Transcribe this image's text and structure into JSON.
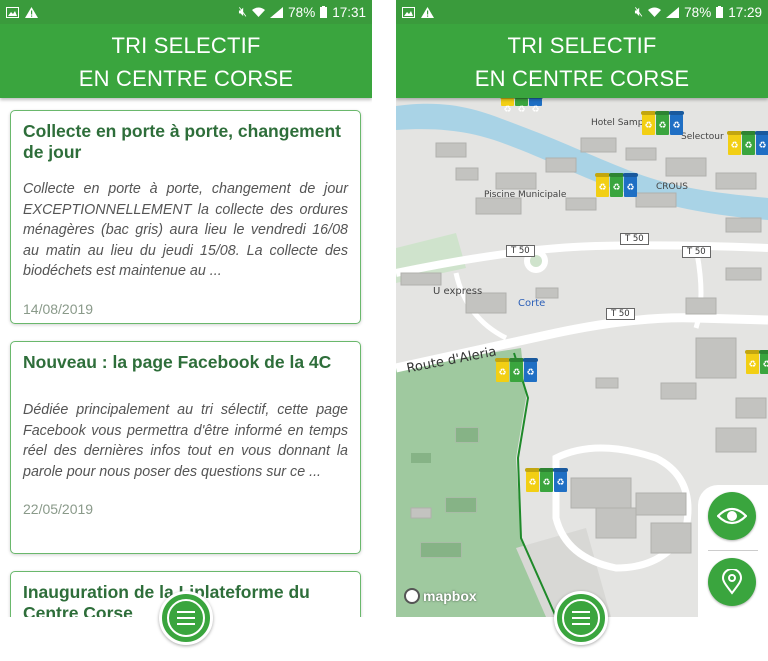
{
  "app": {
    "title_line1": "TRI SELECTIF",
    "title_line2": "EN CENTRE CORSE"
  },
  "left_screen": {
    "status": {
      "battery": "78%",
      "time": "17:31"
    },
    "news": [
      {
        "title": "Collecte en porte à porte, changement de jour",
        "body": "Collecte en porte à porte, changement de jour EXCEPTIONNELLEMENT la collecte des ordures ménagères (bac gris) aura lieu le vendredi 16/08 au matin au lieu du jeudi 15/08. La collecte des biodéchets est maintenue au ...",
        "date": "14/08/2019"
      },
      {
        "title": "Nouveau : la page Facebook de la 4C",
        "body": "Dédiée principalement au tri sélectif, cette page Facebook vous permettra d'être informé en temps réel des dernières infos tout en vous donnant la parole pour nous poser des questions sur ce ...",
        "date": "22/05/2019"
      },
      {
        "title": "Inauguration de la Liplateforme du Centre Corse",
        "body": "",
        "date": ""
      }
    ]
  },
  "right_screen": {
    "status": {
      "battery": "78%",
      "time": "17:29"
    },
    "map_labels": {
      "hotel": "Hotel Sampi",
      "selectour": "Selectour",
      "piscine": "Piscine Municipale",
      "crous": "CROUS",
      "uexpress": "U express",
      "corte": "Corte",
      "road_name": "Route d'Aleria",
      "road_tag": "T 50"
    },
    "attribution": "mapbox"
  },
  "icons": {
    "menu": "hamburger-menu-icon",
    "eye": "eye-icon",
    "location": "map-pin-icon"
  },
  "colors": {
    "primary": "#3aa53e",
    "status_bar": "#3a9b3c",
    "card_title": "#2e6e3a",
    "bin_yellow": "#f2cf14",
    "bin_green": "#3aa53e",
    "bin_blue": "#1f6fc4"
  }
}
